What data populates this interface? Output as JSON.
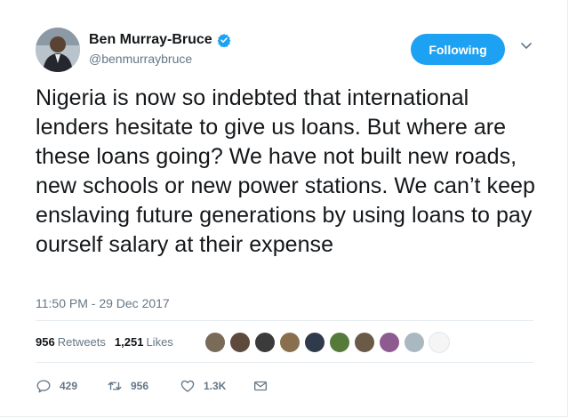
{
  "user": {
    "display_name": "Ben Murray-Bruce",
    "handle": "@benmurraybruce",
    "verified_icon": "verified-badge-icon"
  },
  "follow_button": {
    "label": "Following"
  },
  "menu_icon": "chevron-down-icon",
  "tweet": {
    "text": "Nigeria is now so indebted that international lenders hesitate to give us loans. But where are these loans going? We have not built new roads, new schools or new power stations. We can’t keep enslaving future generations by using loans to pay ourself salary at their expense",
    "timestamp": "11:50 PM - 29 Dec 2017"
  },
  "stats": {
    "retweets_count": "956",
    "retweets_label": "Retweets",
    "likes_count": "1,251",
    "likes_label": "Likes"
  },
  "liker_avatar_colors": [
    "#7a6a58",
    "#5d4a3c",
    "#3b3b3b",
    "#8a6f4e",
    "#2f3b4a",
    "#557a3a",
    "#6b5a47",
    "#8d5b8f",
    "#aab8c2"
  ],
  "actions": {
    "reply": {
      "icon": "reply-icon",
      "count": "429"
    },
    "retweet": {
      "icon": "retweet-icon",
      "count": "956"
    },
    "like": {
      "icon": "heart-icon",
      "count": "1.3K"
    },
    "dm": {
      "icon": "envelope-icon"
    }
  },
  "colors": {
    "accent": "#1da1f2",
    "text": "#14171a",
    "secondary": "#657786",
    "divider": "#e6ecf0"
  }
}
